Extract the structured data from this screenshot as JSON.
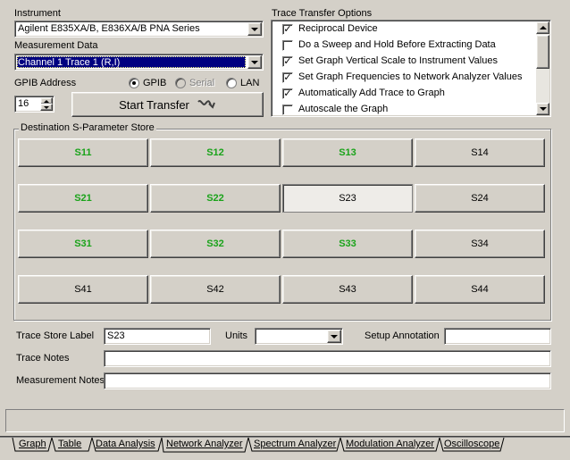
{
  "instrument": {
    "label": "Instrument",
    "value": "Agilent E835XA/B, E836XA/B PNA Series"
  },
  "measurement": {
    "label": "Measurement Data",
    "value": "Channel 1 Trace 1 (R,I)"
  },
  "gpib": {
    "label": "GPIB Address",
    "address": "16",
    "options": [
      {
        "label": "GPIB",
        "selected": true,
        "disabled": false
      },
      {
        "label": "Serial",
        "selected": false,
        "disabled": true
      },
      {
        "label": "LAN",
        "selected": false,
        "disabled": false
      }
    ]
  },
  "start_transfer": {
    "label": "Start Transfer"
  },
  "trace_options": {
    "title": "Trace Transfer Options",
    "items": [
      {
        "label": "Reciprocal Device",
        "checked": true
      },
      {
        "label": "Do a Sweep and Hold Before Extracting Data",
        "checked": false
      },
      {
        "label": "Set Graph Vertical Scale to Instrument Values",
        "checked": true
      },
      {
        "label": "Set Graph Frequencies to Network Analyzer Values",
        "checked": true
      },
      {
        "label": "Automatically Add Trace to Graph",
        "checked": true
      },
      {
        "label": "Autoscale the Graph",
        "checked": false
      }
    ]
  },
  "sparam": {
    "title": "Destination S-Parameter Store",
    "rows": [
      [
        {
          "label": "S11",
          "green": true
        },
        {
          "label": "S12",
          "green": true
        },
        {
          "label": "S13",
          "green": true
        },
        {
          "label": "S14",
          "green": false
        }
      ],
      [
        {
          "label": "S21",
          "green": true
        },
        {
          "label": "S22",
          "green": true
        },
        {
          "label": "S23",
          "green": false,
          "selected": true
        },
        {
          "label": "S24",
          "green": false
        }
      ],
      [
        {
          "label": "S31",
          "green": true
        },
        {
          "label": "S32",
          "green": true
        },
        {
          "label": "S33",
          "green": true
        },
        {
          "label": "S34",
          "green": false
        }
      ],
      [
        {
          "label": "S41",
          "green": false
        },
        {
          "label": "S42",
          "green": false
        },
        {
          "label": "S43",
          "green": false
        },
        {
          "label": "S44",
          "green": false
        }
      ]
    ]
  },
  "fields": {
    "trace_store_label": {
      "label": "Trace Store Label",
      "value": "S23"
    },
    "units": {
      "label": "Units",
      "value": ""
    },
    "setup_annotation": {
      "label": "Setup Annotation",
      "value": ""
    },
    "trace_notes": {
      "label": "Trace Notes",
      "value": ""
    },
    "measurement_notes": {
      "label": "Measurement Notes",
      "value": ""
    }
  },
  "tabs": [
    {
      "label": "Graph",
      "active": false
    },
    {
      "label": "Table",
      "active": false
    },
    {
      "label": "Data Analysis",
      "active": false
    },
    {
      "label": "Network Analyzer",
      "active": true
    },
    {
      "label": "Spectrum Analyzer",
      "active": false
    },
    {
      "label": "Modulation Analyzer",
      "active": false
    },
    {
      "label": "Oscilloscope",
      "active": false
    }
  ],
  "colors": {
    "face": "#d4d0c8",
    "green": "#1aa31a",
    "selection": "#000080"
  }
}
